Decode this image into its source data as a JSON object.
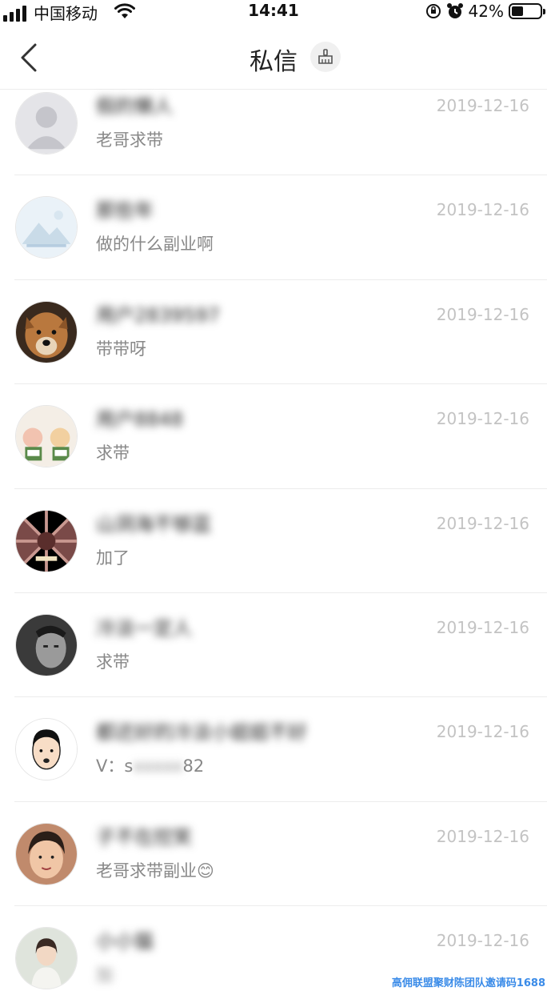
{
  "status_bar": {
    "carrier": "中国移动",
    "time": "14:41",
    "battery": "42%",
    "battery_level": 0.42
  },
  "header": {
    "title": "私信"
  },
  "messages": [
    {
      "name": "假的懒人",
      "preview": "老哥求带",
      "preview_hidden": "",
      "date": "2019-12-16",
      "avatar": "default"
    },
    {
      "name": "那些年",
      "preview": "做的什么副业啊",
      "preview_hidden": "",
      "date": "2019-12-16",
      "avatar": "placeholder"
    },
    {
      "name": "用户2839597",
      "preview": "带带呀",
      "preview_hidden": "",
      "date": "2019-12-16",
      "avatar": "dog"
    },
    {
      "name": "用户8848",
      "preview": "求带",
      "preview_hidden": "",
      "date": "2019-12-16",
      "avatar": "cartoon"
    },
    {
      "name": "山洞海不够蓝",
      "preview": "加了",
      "preview_hidden": "",
      "date": "2019-12-16",
      "avatar": "gem"
    },
    {
      "name": "冷淡一定人",
      "preview": "求带",
      "preview_hidden": "",
      "date": "2019-12-16",
      "avatar": "man"
    },
    {
      "name": "都还好的冷淡小姐姐不好",
      "preview": "V：s",
      "preview_hidden": "xxxxx",
      "preview_tail": "82",
      "date": "2019-12-16",
      "avatar": "cartoonman"
    },
    {
      "name": "子不在控笑",
      "preview": "老哥求带副业",
      "preview_hidden": "",
      "date": "2019-12-16",
      "avatar": "woman",
      "emoji": "😊"
    },
    {
      "name": "小小猫",
      "preview": "加",
      "preview_hidden": "",
      "date": "2019-12-16",
      "avatar": "girl"
    }
  ],
  "watermark": "高佣联盟聚财陈团队邀请码1688"
}
